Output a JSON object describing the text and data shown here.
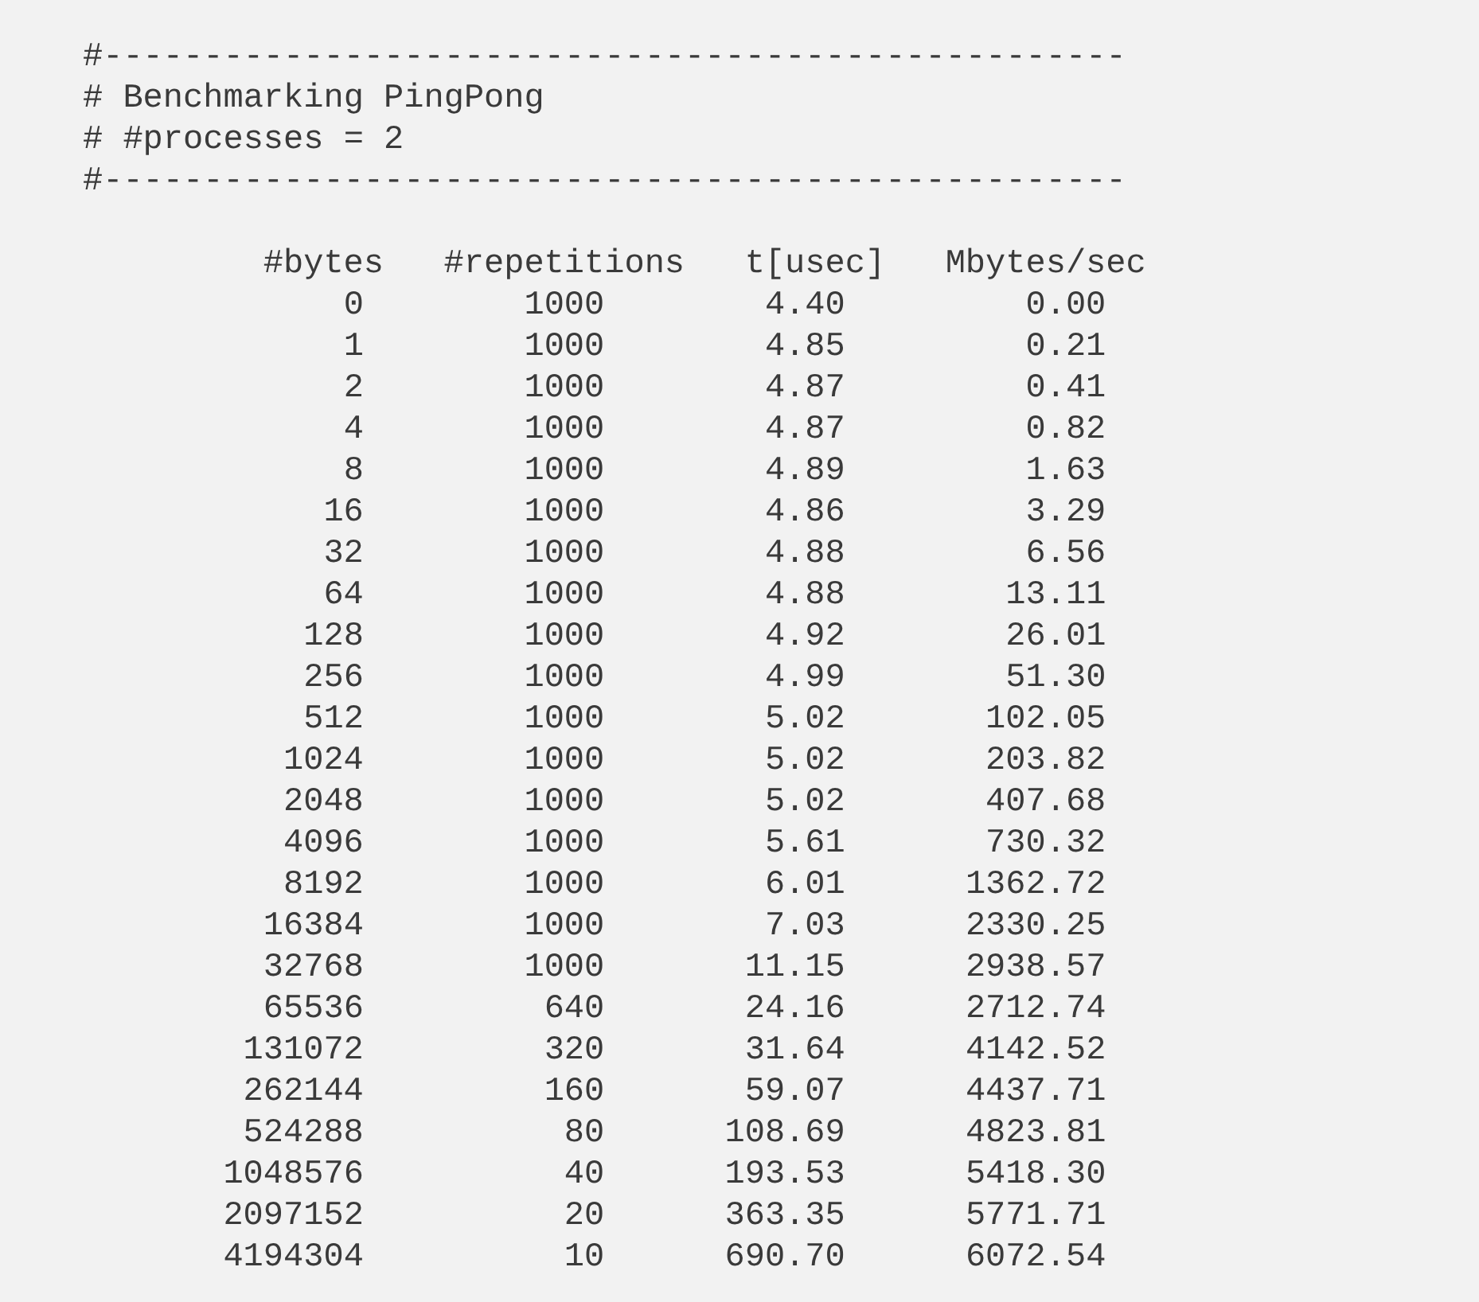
{
  "comment_lines": [
    "#---------------------------------------------------",
    "# Benchmarking PingPong",
    "# #processes = 2",
    "#---------------------------------------------------"
  ],
  "table": {
    "columns": [
      "#bytes",
      "#repetitions",
      "t[usec]",
      "Mbytes/sec"
    ],
    "rows": [
      [
        "0",
        "1000",
        "4.40",
        "0.00"
      ],
      [
        "1",
        "1000",
        "4.85",
        "0.21"
      ],
      [
        "2",
        "1000",
        "4.87",
        "0.41"
      ],
      [
        "4",
        "1000",
        "4.87",
        "0.82"
      ],
      [
        "8",
        "1000",
        "4.89",
        "1.63"
      ],
      [
        "16",
        "1000",
        "4.86",
        "3.29"
      ],
      [
        "32",
        "1000",
        "4.88",
        "6.56"
      ],
      [
        "64",
        "1000",
        "4.88",
        "13.11"
      ],
      [
        "128",
        "1000",
        "4.92",
        "26.01"
      ],
      [
        "256",
        "1000",
        "4.99",
        "51.30"
      ],
      [
        "512",
        "1000",
        "5.02",
        "102.05"
      ],
      [
        "1024",
        "1000",
        "5.02",
        "203.82"
      ],
      [
        "2048",
        "1000",
        "5.02",
        "407.68"
      ],
      [
        "4096",
        "1000",
        "5.61",
        "730.32"
      ],
      [
        "8192",
        "1000",
        "6.01",
        "1362.72"
      ],
      [
        "16384",
        "1000",
        "7.03",
        "2330.25"
      ],
      [
        "32768",
        "1000",
        "11.15",
        "2938.57"
      ],
      [
        "65536",
        "640",
        "24.16",
        "2712.74"
      ],
      [
        "131072",
        "320",
        "31.64",
        "4142.52"
      ],
      [
        "262144",
        "160",
        "59.07",
        "4437.71"
      ],
      [
        "524288",
        "80",
        "108.69",
        "4823.81"
      ],
      [
        "1048576",
        "40",
        "193.53",
        "5418.30"
      ],
      [
        "2097152",
        "20",
        "363.35",
        "5771.71"
      ],
      [
        "4194304",
        "10",
        "690.70",
        "6072.54"
      ]
    ]
  }
}
